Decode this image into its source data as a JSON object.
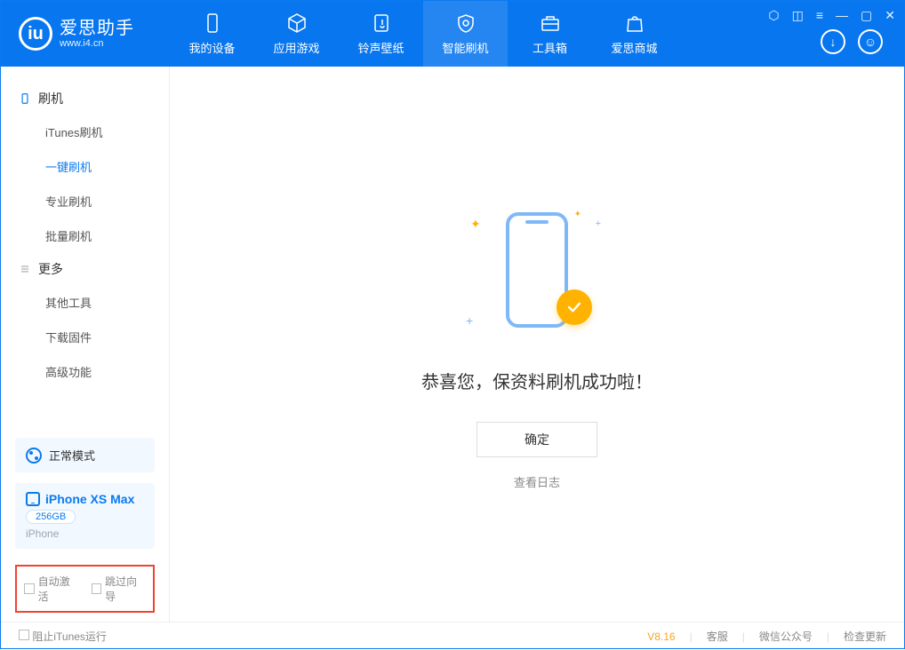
{
  "app": {
    "name": "爱思助手",
    "url": "www.i4.cn"
  },
  "nav": {
    "device": "我的设备",
    "apps": "应用游戏",
    "ring": "铃声壁纸",
    "flash": "智能刷机",
    "tools": "工具箱",
    "store": "爱思商城"
  },
  "sidebar": {
    "section_flash": "刷机",
    "items_flash": {
      "itunes": "iTunes刷机",
      "oneclick": "一键刷机",
      "pro": "专业刷机",
      "batch": "批量刷机"
    },
    "section_more": "更多",
    "items_more": {
      "other": "其他工具",
      "firmware": "下载固件",
      "advanced": "高级功能"
    }
  },
  "mode": {
    "label": "正常模式"
  },
  "device": {
    "name": "iPhone XS Max",
    "capacity": "256GB",
    "type": "iPhone"
  },
  "options": {
    "auto_activate": "自动激活",
    "skip_guide": "跳过向导"
  },
  "main": {
    "success": "恭喜您，保资料刷机成功啦！",
    "confirm": "确定",
    "view_log": "查看日志"
  },
  "footer": {
    "block_itunes": "阻止iTunes运行",
    "version": "V8.16",
    "support": "客服",
    "wechat": "微信公众号",
    "update": "检查更新"
  }
}
